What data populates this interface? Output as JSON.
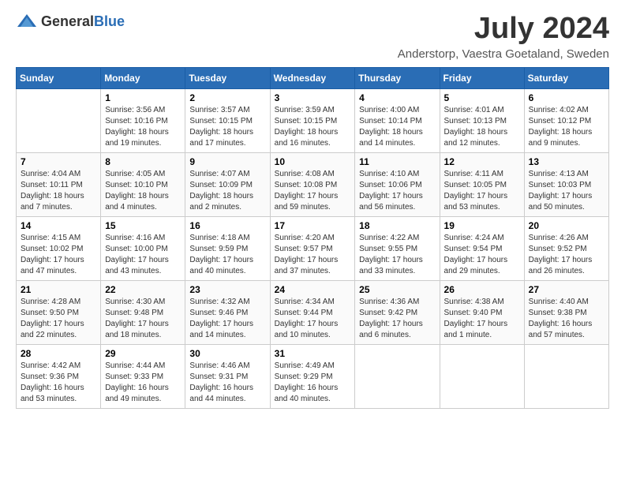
{
  "header": {
    "logo_general": "General",
    "logo_blue": "Blue",
    "month_year": "July 2024",
    "location": "Anderstorp, Vaestra Goetaland, Sweden"
  },
  "weekdays": [
    "Sunday",
    "Monday",
    "Tuesday",
    "Wednesday",
    "Thursday",
    "Friday",
    "Saturday"
  ],
  "weeks": [
    [
      {
        "day": "",
        "info": ""
      },
      {
        "day": "1",
        "info": "Sunrise: 3:56 AM\nSunset: 10:16 PM\nDaylight: 18 hours\nand 19 minutes."
      },
      {
        "day": "2",
        "info": "Sunrise: 3:57 AM\nSunset: 10:15 PM\nDaylight: 18 hours\nand 17 minutes."
      },
      {
        "day": "3",
        "info": "Sunrise: 3:59 AM\nSunset: 10:15 PM\nDaylight: 18 hours\nand 16 minutes."
      },
      {
        "day": "4",
        "info": "Sunrise: 4:00 AM\nSunset: 10:14 PM\nDaylight: 18 hours\nand 14 minutes."
      },
      {
        "day": "5",
        "info": "Sunrise: 4:01 AM\nSunset: 10:13 PM\nDaylight: 18 hours\nand 12 minutes."
      },
      {
        "day": "6",
        "info": "Sunrise: 4:02 AM\nSunset: 10:12 PM\nDaylight: 18 hours\nand 9 minutes."
      }
    ],
    [
      {
        "day": "7",
        "info": "Sunrise: 4:04 AM\nSunset: 10:11 PM\nDaylight: 18 hours\nand 7 minutes."
      },
      {
        "day": "8",
        "info": "Sunrise: 4:05 AM\nSunset: 10:10 PM\nDaylight: 18 hours\nand 4 minutes."
      },
      {
        "day": "9",
        "info": "Sunrise: 4:07 AM\nSunset: 10:09 PM\nDaylight: 18 hours\nand 2 minutes."
      },
      {
        "day": "10",
        "info": "Sunrise: 4:08 AM\nSunset: 10:08 PM\nDaylight: 17 hours\nand 59 minutes."
      },
      {
        "day": "11",
        "info": "Sunrise: 4:10 AM\nSunset: 10:06 PM\nDaylight: 17 hours\nand 56 minutes."
      },
      {
        "day": "12",
        "info": "Sunrise: 4:11 AM\nSunset: 10:05 PM\nDaylight: 17 hours\nand 53 minutes."
      },
      {
        "day": "13",
        "info": "Sunrise: 4:13 AM\nSunset: 10:03 PM\nDaylight: 17 hours\nand 50 minutes."
      }
    ],
    [
      {
        "day": "14",
        "info": "Sunrise: 4:15 AM\nSunset: 10:02 PM\nDaylight: 17 hours\nand 47 minutes."
      },
      {
        "day": "15",
        "info": "Sunrise: 4:16 AM\nSunset: 10:00 PM\nDaylight: 17 hours\nand 43 minutes."
      },
      {
        "day": "16",
        "info": "Sunrise: 4:18 AM\nSunset: 9:59 PM\nDaylight: 17 hours\nand 40 minutes."
      },
      {
        "day": "17",
        "info": "Sunrise: 4:20 AM\nSunset: 9:57 PM\nDaylight: 17 hours\nand 37 minutes."
      },
      {
        "day": "18",
        "info": "Sunrise: 4:22 AM\nSunset: 9:55 PM\nDaylight: 17 hours\nand 33 minutes."
      },
      {
        "day": "19",
        "info": "Sunrise: 4:24 AM\nSunset: 9:54 PM\nDaylight: 17 hours\nand 29 minutes."
      },
      {
        "day": "20",
        "info": "Sunrise: 4:26 AM\nSunset: 9:52 PM\nDaylight: 17 hours\nand 26 minutes."
      }
    ],
    [
      {
        "day": "21",
        "info": "Sunrise: 4:28 AM\nSunset: 9:50 PM\nDaylight: 17 hours\nand 22 minutes."
      },
      {
        "day": "22",
        "info": "Sunrise: 4:30 AM\nSunset: 9:48 PM\nDaylight: 17 hours\nand 18 minutes."
      },
      {
        "day": "23",
        "info": "Sunrise: 4:32 AM\nSunset: 9:46 PM\nDaylight: 17 hours\nand 14 minutes."
      },
      {
        "day": "24",
        "info": "Sunrise: 4:34 AM\nSunset: 9:44 PM\nDaylight: 17 hours\nand 10 minutes."
      },
      {
        "day": "25",
        "info": "Sunrise: 4:36 AM\nSunset: 9:42 PM\nDaylight: 17 hours\nand 6 minutes."
      },
      {
        "day": "26",
        "info": "Sunrise: 4:38 AM\nSunset: 9:40 PM\nDaylight: 17 hours\nand 1 minute."
      },
      {
        "day": "27",
        "info": "Sunrise: 4:40 AM\nSunset: 9:38 PM\nDaylight: 16 hours\nand 57 minutes."
      }
    ],
    [
      {
        "day": "28",
        "info": "Sunrise: 4:42 AM\nSunset: 9:36 PM\nDaylight: 16 hours\nand 53 minutes."
      },
      {
        "day": "29",
        "info": "Sunrise: 4:44 AM\nSunset: 9:33 PM\nDaylight: 16 hours\nand 49 minutes."
      },
      {
        "day": "30",
        "info": "Sunrise: 4:46 AM\nSunset: 9:31 PM\nDaylight: 16 hours\nand 44 minutes."
      },
      {
        "day": "31",
        "info": "Sunrise: 4:49 AM\nSunset: 9:29 PM\nDaylight: 16 hours\nand 40 minutes."
      },
      {
        "day": "",
        "info": ""
      },
      {
        "day": "",
        "info": ""
      },
      {
        "day": "",
        "info": ""
      }
    ]
  ]
}
